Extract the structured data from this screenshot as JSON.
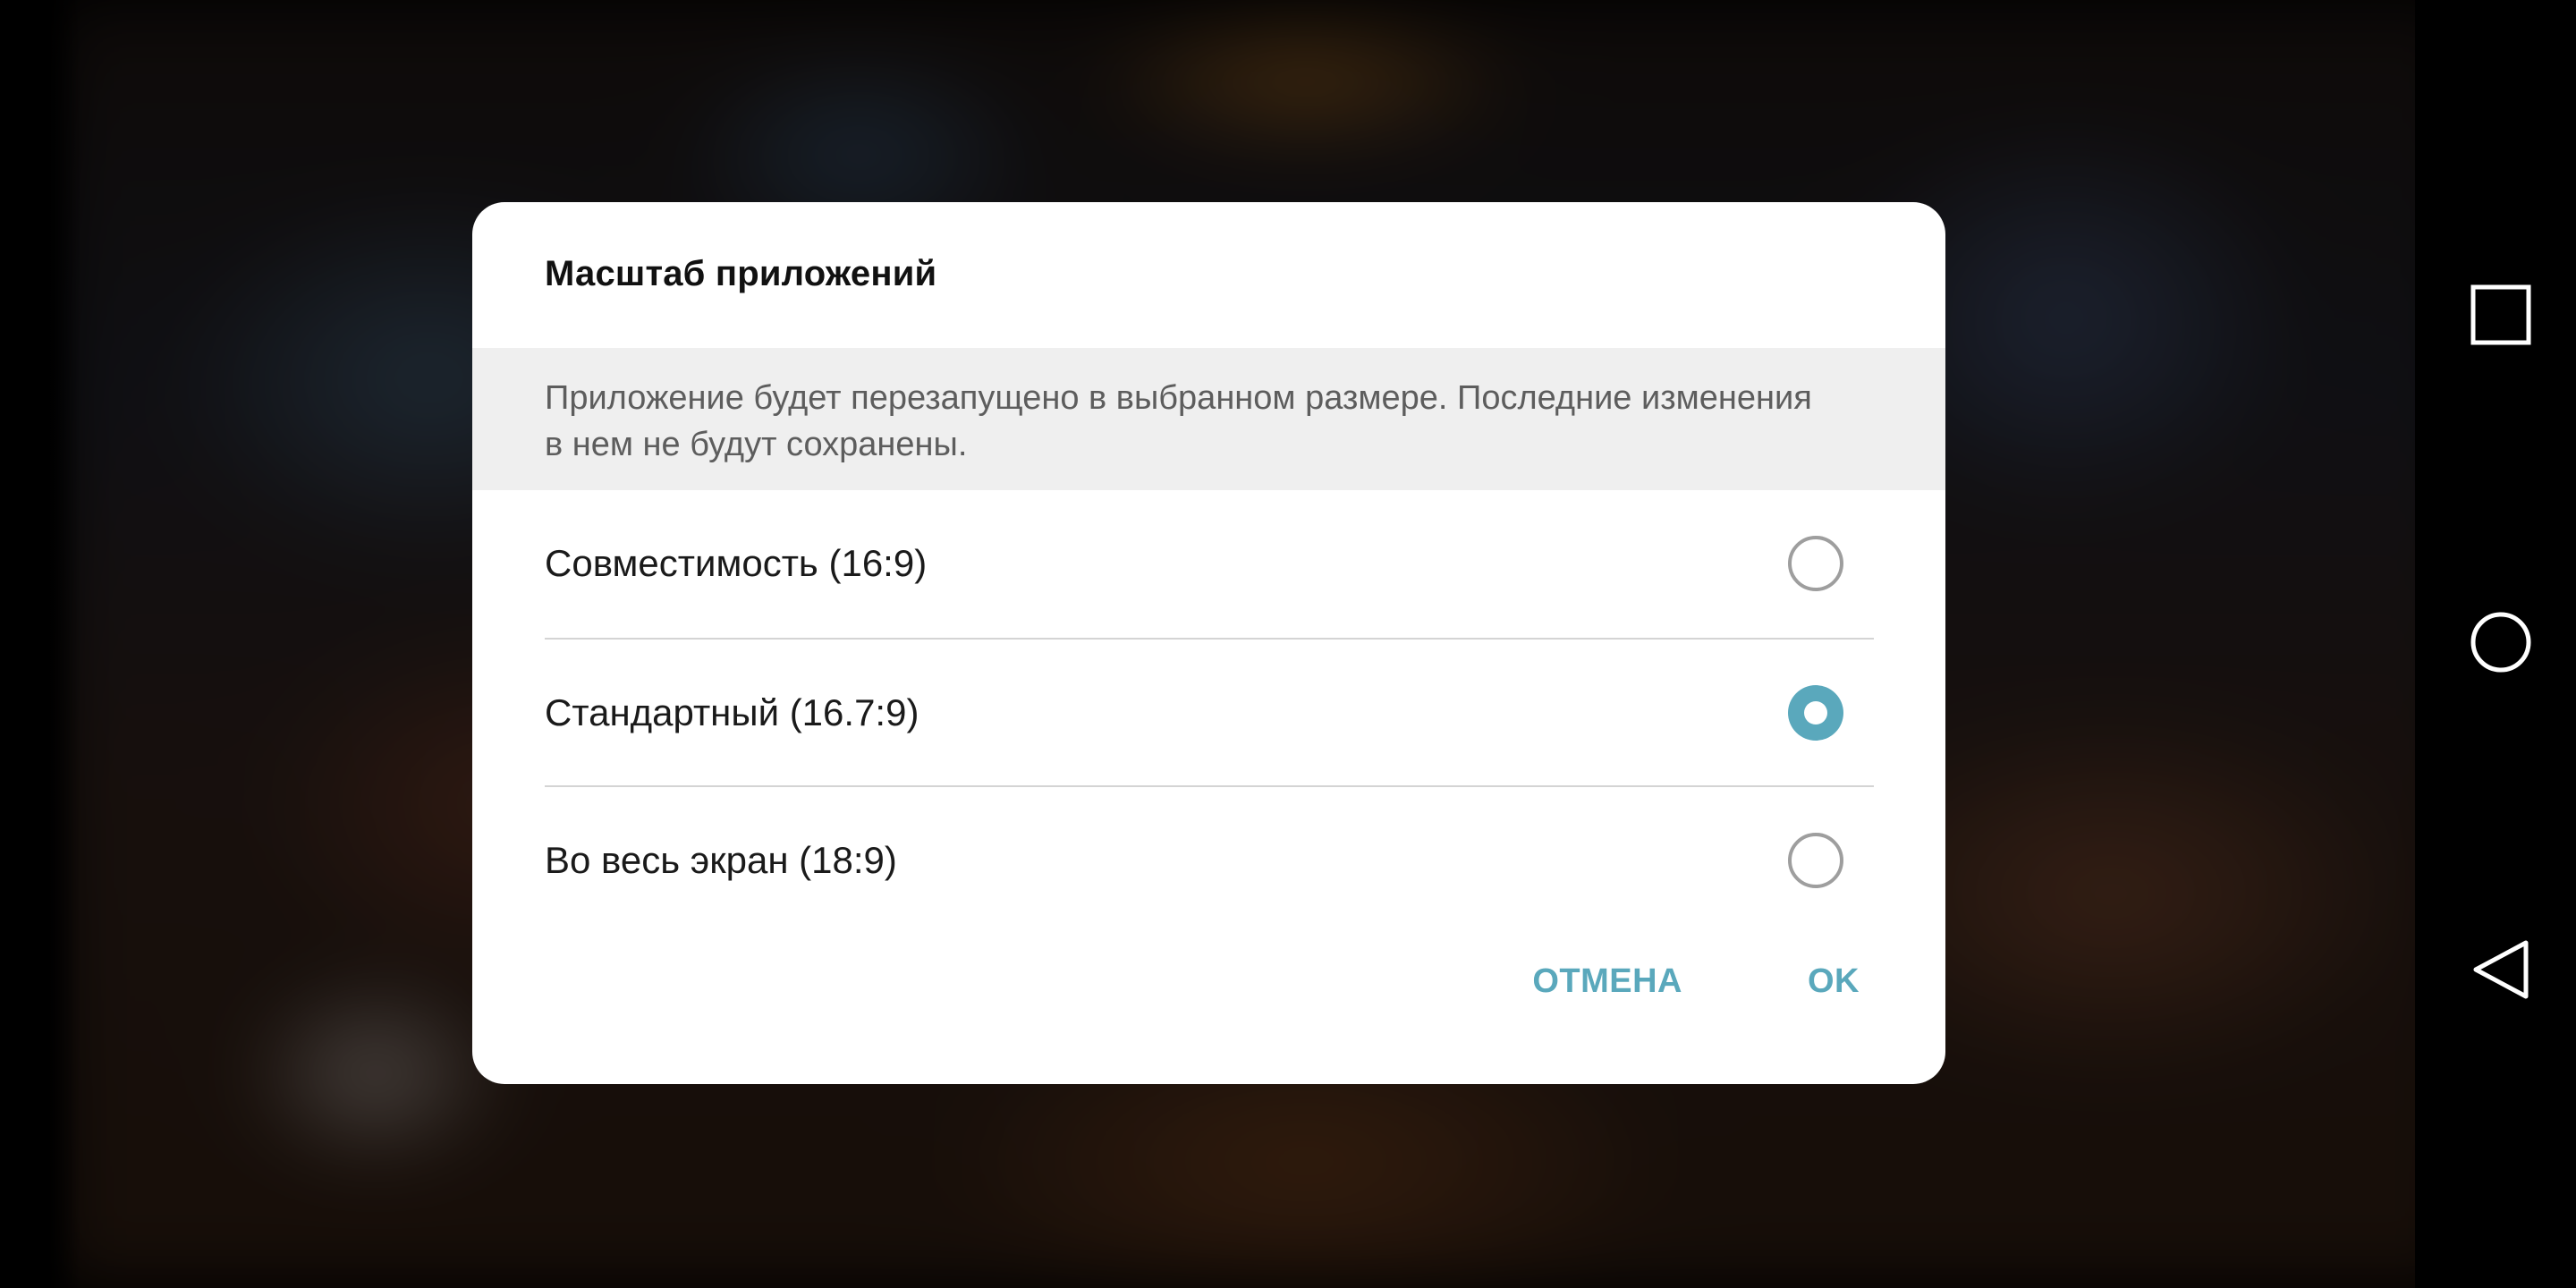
{
  "dialog": {
    "title": "Масштаб приложений",
    "description": "Приложение будет перезапущено в выбранном размере. Последние изменения в нем не будут сохранены.",
    "options": [
      {
        "label": "Совместимость (16:9)",
        "selected": false
      },
      {
        "label": "Стандартный (16.7:9)",
        "selected": true
      },
      {
        "label": "Во весь экран (18:9)",
        "selected": false
      }
    ],
    "cancel_label": "ОТМЕНА",
    "ok_label": "OK",
    "accent_color": "#5aa8bc"
  },
  "nav_bar": {
    "items": [
      {
        "icon": "recents-square-icon"
      },
      {
        "icon": "home-circle-icon"
      },
      {
        "icon": "back-triangle-icon"
      }
    ]
  }
}
